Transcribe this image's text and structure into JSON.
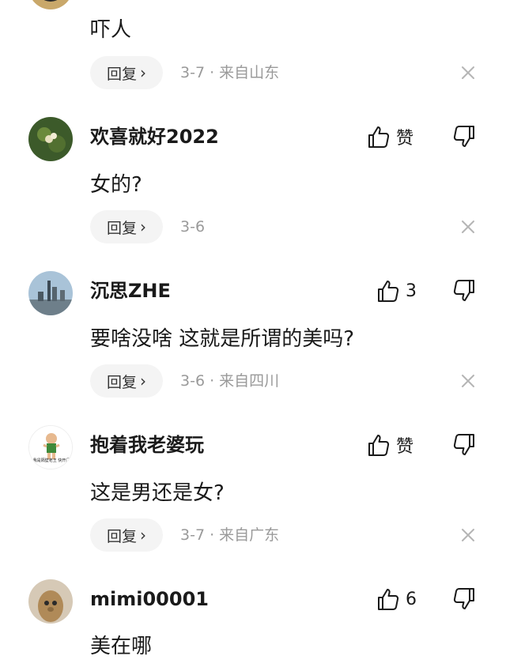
{
  "comments": [
    {
      "content": "吓人",
      "reply_label": "回复",
      "meta": "3-7 · 来自山东"
    },
    {
      "username": "欢喜就好2022",
      "content": "女的?",
      "like_label": "赞",
      "reply_label": "回复",
      "meta": "3-6"
    },
    {
      "username": "沉思ZHE",
      "content": "要啥没啥 这就是所谓的美吗?",
      "like_label": "3",
      "reply_label": "回复",
      "meta": "3-6 · 来自四川"
    },
    {
      "username": "抱着我老婆玩",
      "content": "这是男还是女?",
      "like_label": "赞",
      "reply_label": "回复",
      "meta": "3-7 · 来自广东",
      "avatar_text": "我是隔壁老王 快开门"
    },
    {
      "username": "mimi00001",
      "content": "美在哪",
      "like_label": "6"
    }
  ],
  "icons": {
    "reply_chevron": "›",
    "like": "thumbs-up-icon",
    "dislike": "thumbs-down-icon",
    "close": "close-icon"
  },
  "colors": {
    "text": "#1a1a1a",
    "meta": "#9a9a9a",
    "reply_bg": "#f4f4f4"
  }
}
